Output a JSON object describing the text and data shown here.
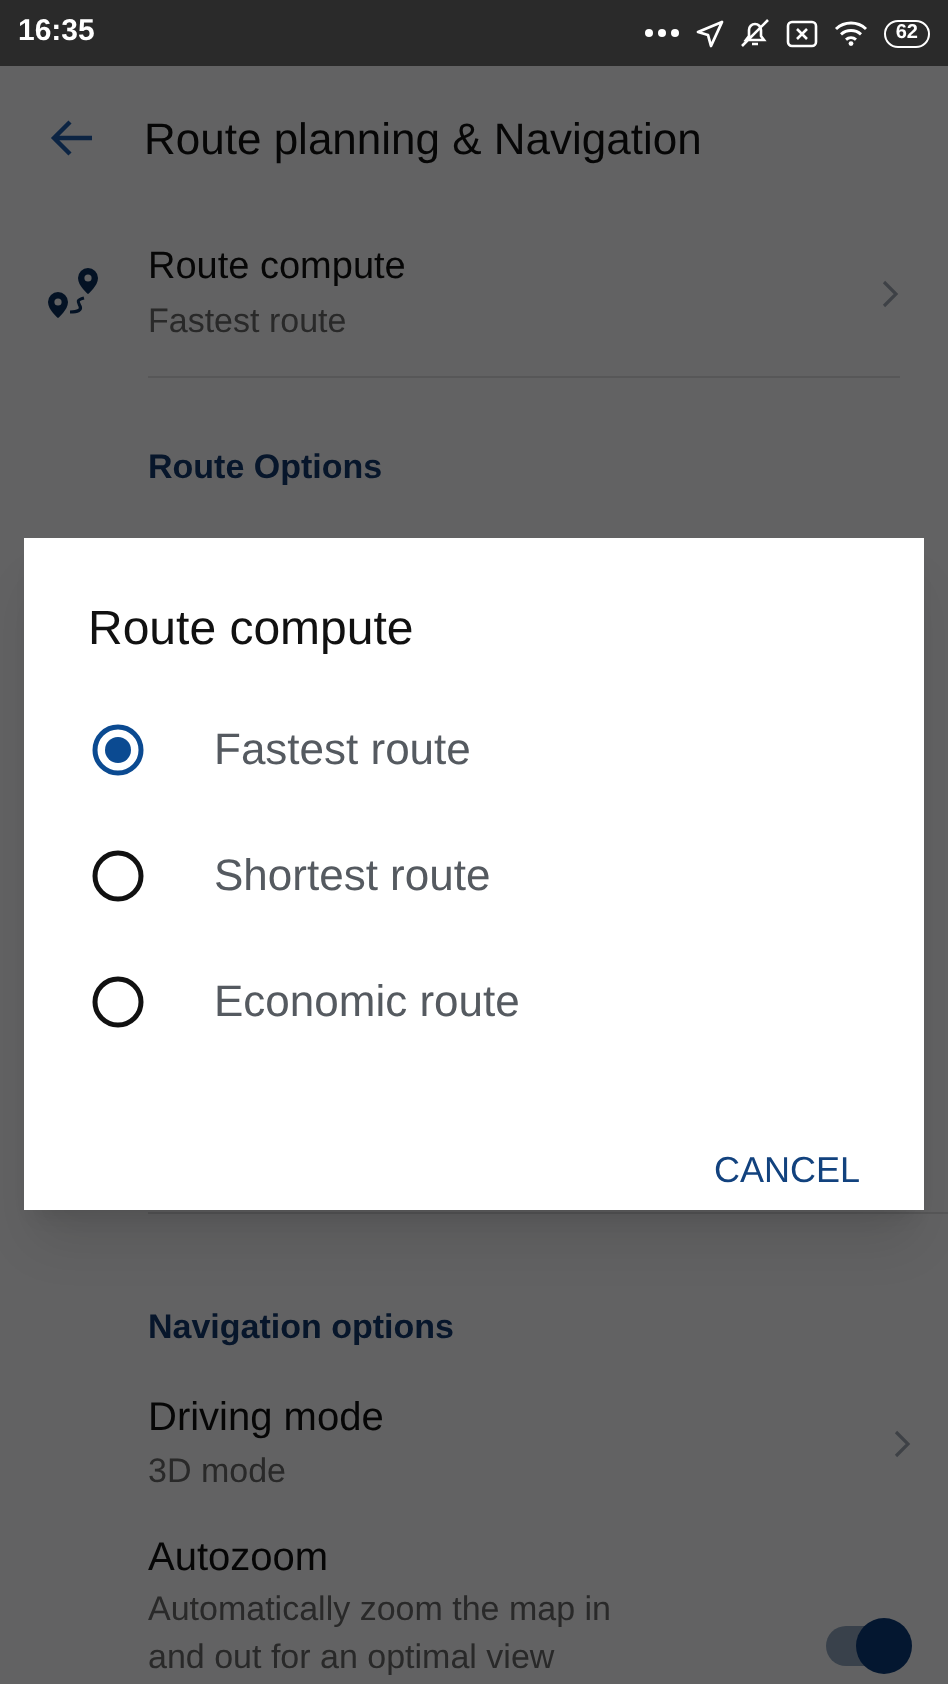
{
  "status_bar": {
    "time": "16:35",
    "battery": "62"
  },
  "header": {
    "title": "Route planning & Navigation"
  },
  "route_compute": {
    "title": "Route compute",
    "value": "Fastest route"
  },
  "route_options": {
    "heading": "Route Options"
  },
  "navigation_options": {
    "heading": "Navigation options",
    "items": [
      {
        "kind": "link",
        "title": "Driving mode",
        "value": "3D mode"
      },
      {
        "kind": "toggle",
        "title": "Autozoom",
        "description": "Automatically zoom the map in and out for an optimal view",
        "on": true
      }
    ]
  },
  "dialog": {
    "title": "Route compute",
    "options": [
      {
        "label": "Fastest route",
        "selected": true
      },
      {
        "label": "Shortest route",
        "selected": false
      },
      {
        "label": "Economic route",
        "selected": false
      }
    ],
    "button": "CANCEL"
  }
}
